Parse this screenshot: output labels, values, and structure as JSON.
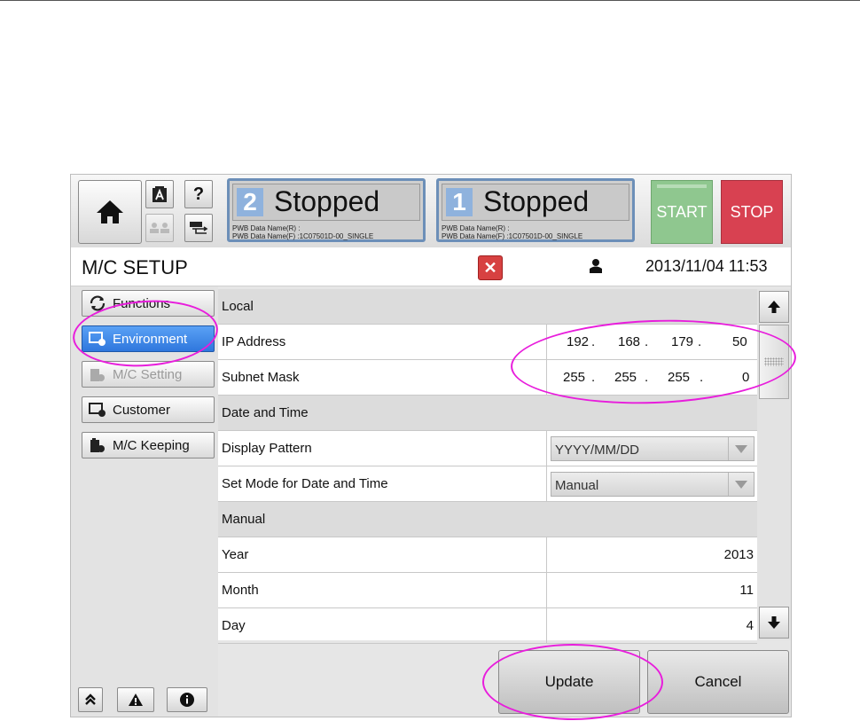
{
  "header": {
    "status_left": {
      "number": "2",
      "state": "Stopped",
      "pwb_r": "PWB Data Name(R) :",
      "pwb_f": "PWB Data Name(F) :1C07501D-00_SINGLE"
    },
    "status_right": {
      "number": "1",
      "state": "Stopped",
      "pwb_r": "PWB Data Name(R) :",
      "pwb_f": "PWB Data Name(F) :1C07501D-00_SINGLE"
    },
    "start_label": "START",
    "stop_label": "STOP",
    "question_label": "?"
  },
  "titlebar": {
    "title": "M/C SETUP",
    "close_glyph": "✕",
    "datetime": "2013/11/04 11:53"
  },
  "nav": {
    "items": [
      {
        "label": "Functions",
        "state": "normal"
      },
      {
        "label": "Environment",
        "state": "active"
      },
      {
        "label": "M/C Setting",
        "state": "disabled"
      },
      {
        "label": "Customer",
        "state": "normal"
      },
      {
        "label": "M/C Keeping",
        "state": "normal"
      }
    ]
  },
  "table": {
    "section_local": "Local",
    "ip_address": {
      "label": "IP Address",
      "octets": [
        "192",
        "168",
        "179",
        "50"
      ]
    },
    "subnet_mask": {
      "label": "Subnet Mask",
      "octets": [
        "255",
        "255",
        "255",
        "0"
      ]
    },
    "section_datetime": "Date and Time",
    "display_pattern": {
      "label": "Display Pattern",
      "value": "YYYY/MM/DD"
    },
    "set_mode": {
      "label": "Set Mode for Date and Time",
      "value": "Manual"
    },
    "section_manual": "Manual",
    "year": {
      "label": "Year",
      "value": "2013"
    },
    "month": {
      "label": "Month",
      "value": "11"
    },
    "day": {
      "label": "Day",
      "value": "4"
    }
  },
  "buttons": {
    "update": "Update",
    "cancel": "Cancel"
  },
  "colors": {
    "annotation": "#e81ddc",
    "active_nav": "#2f77dd",
    "start": "#8fc78f",
    "stop": "#d84151",
    "status_border": "#6c8fb8"
  }
}
